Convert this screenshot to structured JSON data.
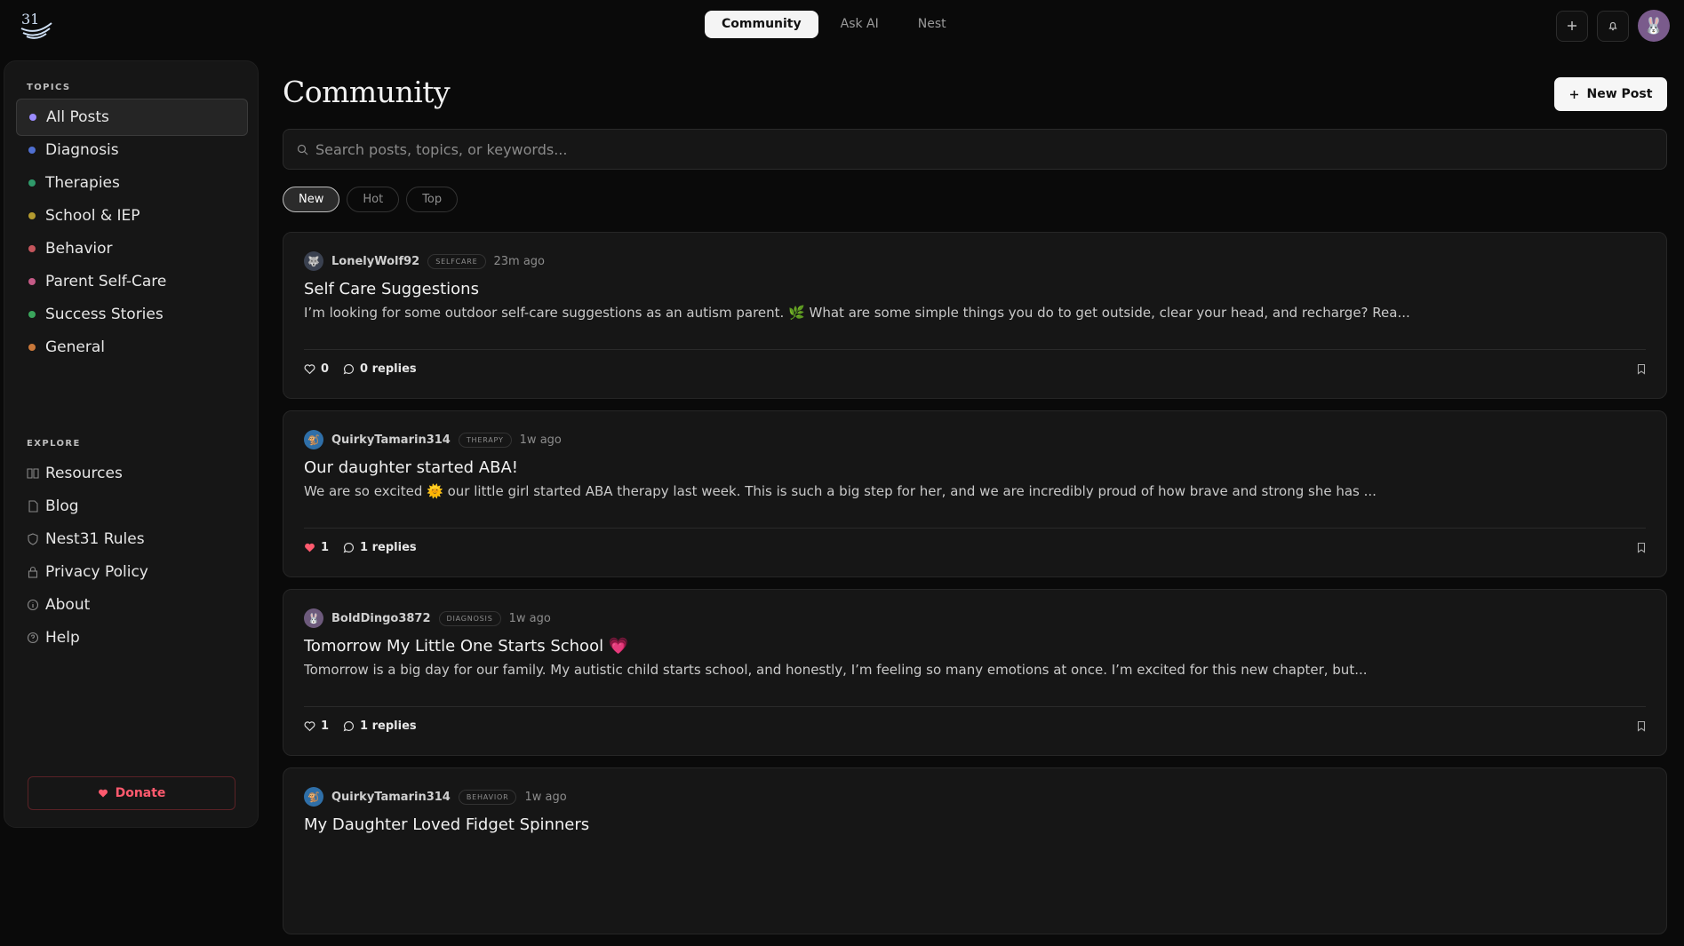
{
  "nav": {
    "tabs": [
      {
        "label": "Community",
        "active": true
      },
      {
        "label": "Ask AI",
        "active": false
      },
      {
        "label": "Nest",
        "active": false
      }
    ]
  },
  "sidebar": {
    "topics_label": "TOPICS",
    "topics": [
      {
        "label": "All Posts",
        "color": "#9b8cff",
        "active": true
      },
      {
        "label": "Diagnosis",
        "color": "#4f6fd1"
      },
      {
        "label": "Therapies",
        "color": "#2f9a6a"
      },
      {
        "label": "School & IEP",
        "color": "#b39a2f"
      },
      {
        "label": "Behavior",
        "color": "#c4555c"
      },
      {
        "label": "Parent Self-Care",
        "color": "#c45a86"
      },
      {
        "label": "Success Stories",
        "color": "#3aa55c"
      },
      {
        "label": "General",
        "color": "#c9783a"
      }
    ],
    "explore_label": "EXPLORE",
    "explore": [
      {
        "label": "Resources",
        "icon": "book-icon"
      },
      {
        "label": "Blog",
        "icon": "document-icon"
      },
      {
        "label": "Nest31 Rules",
        "icon": "shield-icon"
      },
      {
        "label": "Privacy Policy",
        "icon": "lock-icon"
      },
      {
        "label": "About",
        "icon": "info-icon"
      },
      {
        "label": "Help",
        "icon": "help-icon"
      }
    ],
    "donate_label": "Donate"
  },
  "main": {
    "title": "Community",
    "new_post_label": "New Post",
    "search_placeholder": "Search posts, topics, or keywords...",
    "filters": [
      {
        "label": "New",
        "active": true
      },
      {
        "label": "Hot",
        "active": false
      },
      {
        "label": "Top",
        "active": false
      }
    ],
    "posts": [
      {
        "author": "LonelyWolf92",
        "badge": "SELFCARE",
        "time": "23m ago",
        "title": "Self Care Suggestions",
        "excerpt": "I’m looking for some outdoor self-care suggestions as an autism parent. 🌿 What are some simple things you do to get outside, clear your head, and recharge? Rea...",
        "likes": "0",
        "replies": "0 replies",
        "liked": false,
        "avatar": "🐺",
        "avatar_bg": "#3a4150"
      },
      {
        "author": "QuirkyTamarin314",
        "badge": "THERAPY",
        "time": "1w ago",
        "title": "Our daughter started ABA!",
        "excerpt": "We are so excited 🌞 our little girl started ABA therapy last week. This is such a big step for her, and we are incredibly proud of how brave and strong she has ...",
        "likes": "1",
        "replies": "1 replies",
        "liked": true,
        "avatar": "🐒",
        "avatar_bg": "#2f6fa8"
      },
      {
        "author": "BoldDingo3872",
        "badge": "DIAGNOSIS",
        "time": "1w ago",
        "title": "Tomorrow My Little One Starts School 💗",
        "excerpt": "Tomorrow is a big day for our family. My autistic child starts school, and honestly, I’m feeling so many emotions at once. I’m excited for this new chapter, but...",
        "likes": "1",
        "replies": "1 replies",
        "liked": false,
        "avatar": "🐰",
        "avatar_bg": "#6d5a7c"
      },
      {
        "author": "QuirkyTamarin314",
        "badge": "BEHAVIOR",
        "time": "1w ago",
        "title": "My Daughter Loved Fidget Spinners",
        "excerpt": "",
        "likes": "",
        "replies": "",
        "liked": false,
        "avatar": "🐒",
        "avatar_bg": "#2f6fa8"
      }
    ]
  }
}
